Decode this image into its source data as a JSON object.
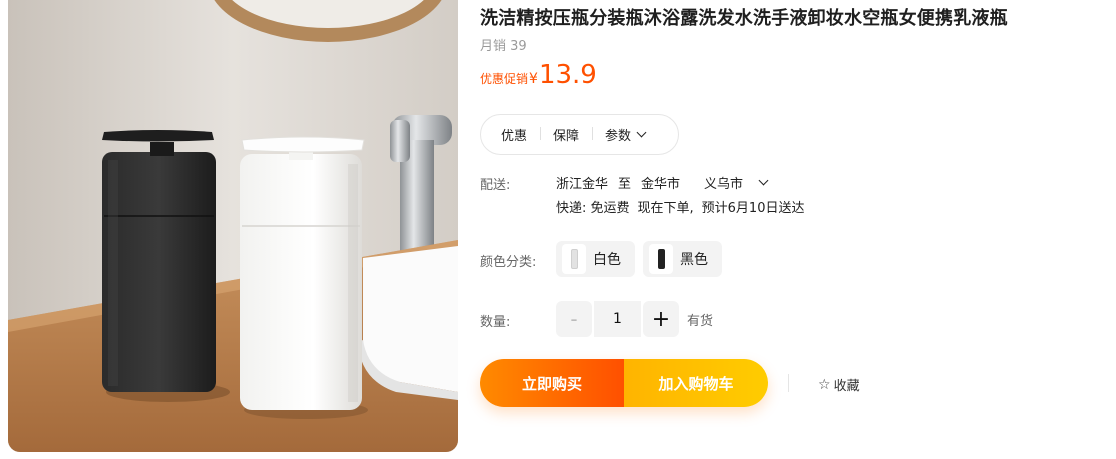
{
  "product": {
    "title": "洗洁精按压瓶分装瓶沐浴露洗发水洗手液卸妆水空瓶女便携乳液瓶",
    "sales": "月销 39",
    "price_tag": "优惠促销",
    "currency": "¥",
    "price": "13.9",
    "accent_color": "#ff5000"
  },
  "pill_tabs": {
    "promo": "优惠",
    "guarantee": "保障",
    "params": "参数"
  },
  "delivery": {
    "label": "配送:",
    "from": "浙江金华",
    "to_word": "至",
    "city": "金华市",
    "district": "义乌市",
    "express": "快递: 免运费",
    "order_now": "现在下单,",
    "eta": "预计6月10日送达"
  },
  "color": {
    "label": "颜色分类:",
    "options": [
      "白色",
      "黑色"
    ]
  },
  "quantity": {
    "label": "数量:",
    "minus": "-",
    "value": "1",
    "plus": "+",
    "stock": "有货"
  },
  "actions": {
    "buy_now": "立即购买",
    "add_to_cart": "加入购物车",
    "favorite": "收藏",
    "buy_color": "#ff5000",
    "cart_color": "#ffc400"
  }
}
